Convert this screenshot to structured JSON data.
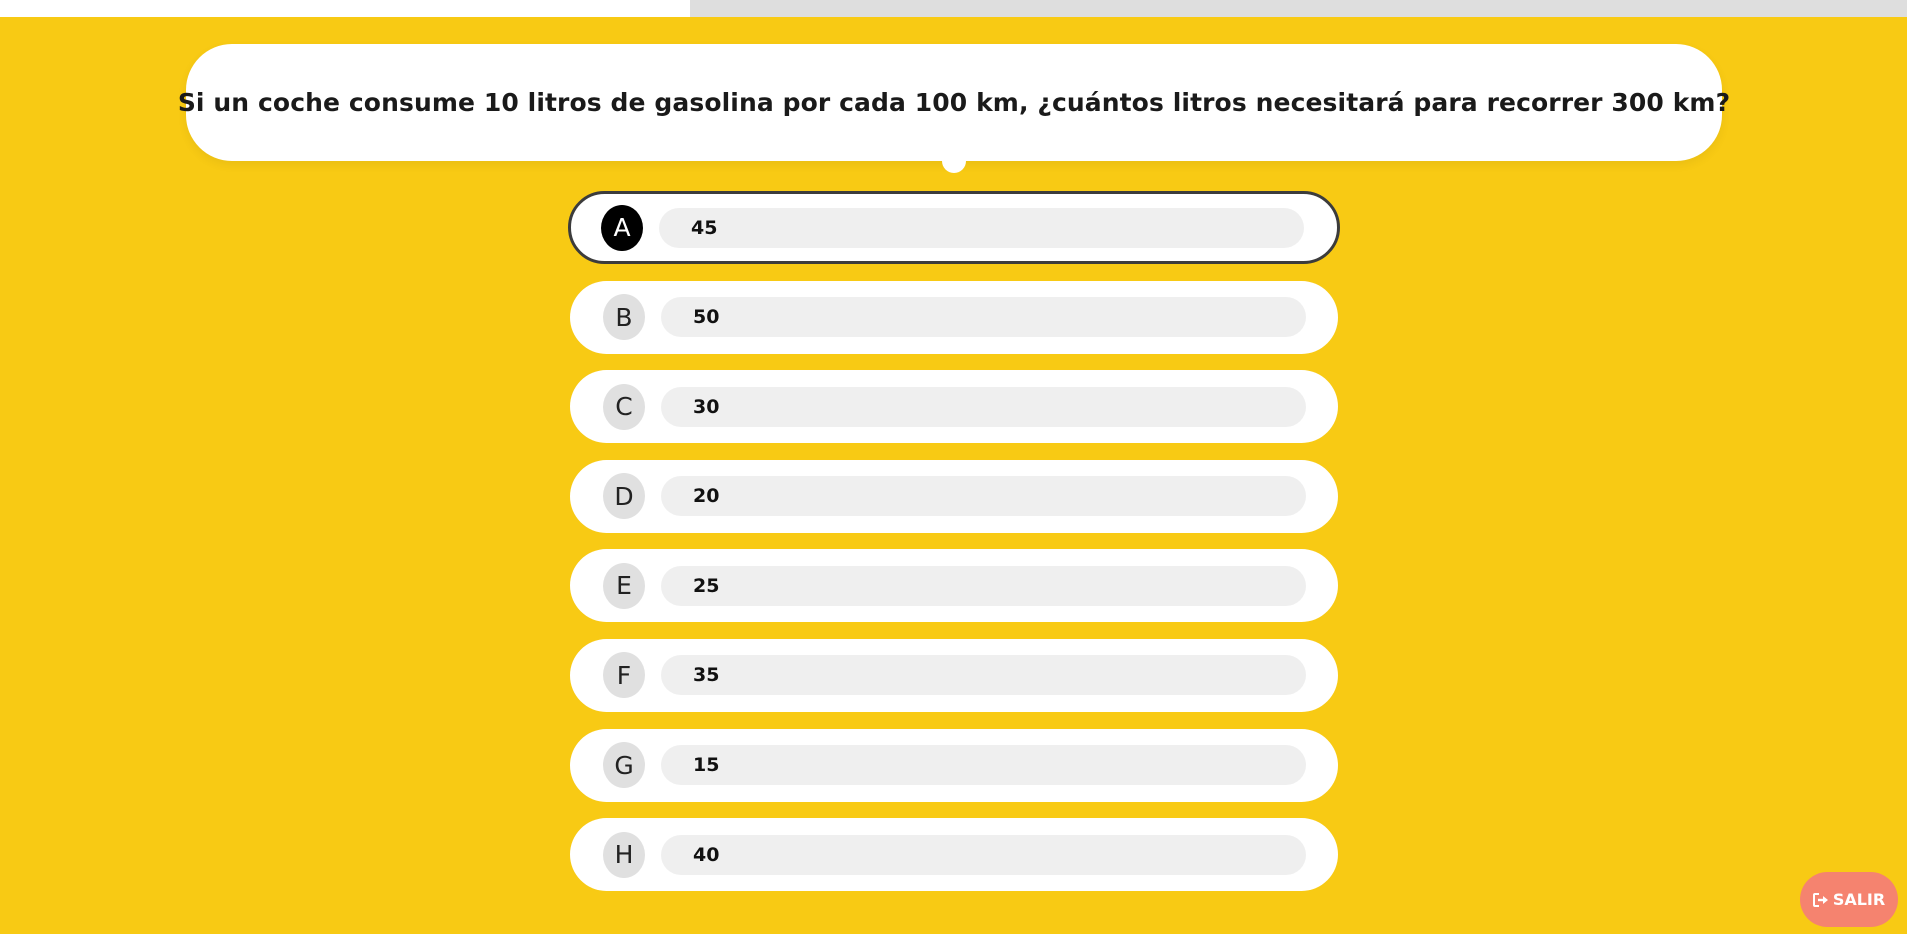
{
  "progress": {
    "fraction": 0.362
  },
  "question": {
    "text": "Si un coche consume 10 litros de gasolina por cada 100 km, ¿cuántos litros necesitará para recorrer 300 km?"
  },
  "options": [
    {
      "letter": "A",
      "value": "45"
    },
    {
      "letter": "B",
      "value": "50"
    },
    {
      "letter": "C",
      "value": "30"
    },
    {
      "letter": "D",
      "value": "20"
    },
    {
      "letter": "E",
      "value": "25"
    },
    {
      "letter": "F",
      "value": "35"
    },
    {
      "letter": "G",
      "value": "15"
    },
    {
      "letter": "H",
      "value": "40"
    }
  ],
  "selected_option": "A",
  "exit_button": {
    "label": "SALIR",
    "icon": "sign-out-icon"
  },
  "colors": {
    "background": "#f8ca14",
    "card": "#ffffff",
    "exit_button": "#f5836f",
    "selected_letter": "#000000"
  }
}
